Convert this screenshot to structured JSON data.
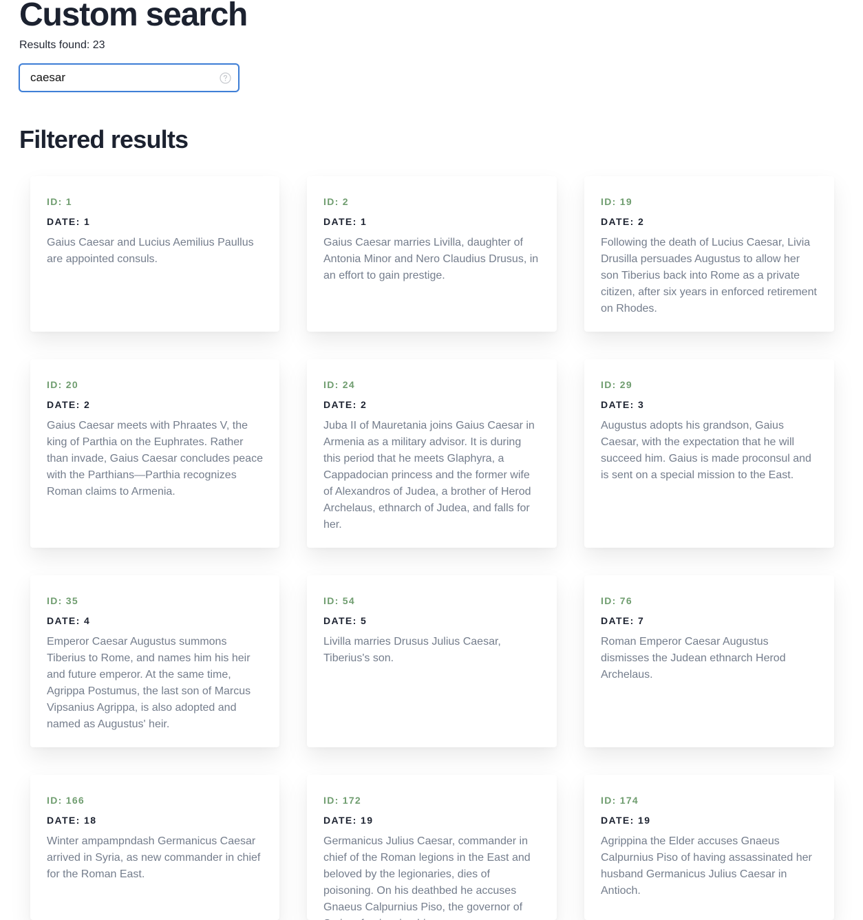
{
  "header": {
    "title": "Custom search",
    "results_text": "Results found: 23"
  },
  "search": {
    "value": "caesar",
    "placeholder": "",
    "help_icon": "question-circle-icon"
  },
  "section": {
    "title": "Filtered results"
  },
  "cards": [
    {
      "id_label": "ID: 1",
      "date_label": "DATE: 1",
      "text": "Gaius Caesar and Lucius Aemilius Paullus are appointed consuls."
    },
    {
      "id_label": "ID: 2",
      "date_label": "DATE: 1",
      "text": "Gaius Caesar marries Livilla, daughter of Antonia Minor and Nero Claudius Drusus, in an effort to gain prestige."
    },
    {
      "id_label": "ID: 19",
      "date_label": "DATE: 2",
      "text": "Following the death of Lucius Caesar, Livia Drusilla persuades Augustus to allow her son Tiberius back into Rome as a private citizen, after six years in enforced retirement on Rhodes."
    },
    {
      "id_label": "ID: 20",
      "date_label": "DATE: 2",
      "text": "Gaius Caesar meets with Phraates V, the king of Parthia on the Euphrates. Rather than invade, Gaius Caesar concludes peace with the Parthians—Parthia recognizes Roman claims to Armenia."
    },
    {
      "id_label": "ID: 24",
      "date_label": "DATE: 2",
      "text": "Juba II of Mauretania joins Gaius Caesar in Armenia as a military advisor. It is during this period that he meets Glaphyra, a Cappadocian princess and the former wife of Alexandros of Judea, a brother of Herod Archelaus, ethnarch of Judea, and falls for her."
    },
    {
      "id_label": "ID: 29",
      "date_label": "DATE: 3",
      "text": "Augustus adopts his grandson, Gaius Caesar, with the expectation that he will succeed him. Gaius is made proconsul and is sent on a special mission to the East."
    },
    {
      "id_label": "ID: 35",
      "date_label": "DATE: 4",
      "text": "Emperor Caesar Augustus summons Tiberius to Rome, and names him his heir and future emperor. At the same time, Agrippa Postumus, the last son of Marcus Vipsanius Agrippa, is also adopted and named as Augustus' heir."
    },
    {
      "id_label": "ID: 54",
      "date_label": "DATE: 5",
      "text": "Livilla marries Drusus Julius Caesar, Tiberius's son."
    },
    {
      "id_label": "ID: 76",
      "date_label": "DATE: 7",
      "text": "Roman Emperor Caesar Augustus dismisses the Judean ethnarch Herod Archelaus."
    },
    {
      "id_label": "ID: 166",
      "date_label": "DATE: 18",
      "text": "Winter ampampndash Germanicus Caesar arrived in Syria, as new commander in chief for the Roman East."
    },
    {
      "id_label": "ID: 172",
      "date_label": "DATE: 19",
      "text": "Germanicus Julius Caesar, commander in chief of the Roman legions in the East and beloved by the legionaries, dies of poisoning. On his deathbed he accuses Gnaeus Calpurnius Piso, the governor of Syria, of poisoning him."
    },
    {
      "id_label": "ID: 174",
      "date_label": "DATE: 19",
      "text": "Agrippina the Elder accuses Gnaeus Calpurnius Piso of having assassinated her husband Germanicus Julius Caesar in Antioch."
    }
  ]
}
